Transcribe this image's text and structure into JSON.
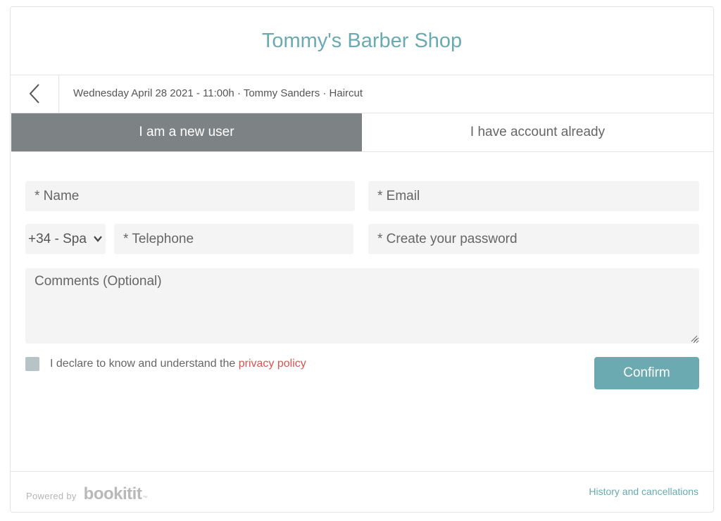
{
  "header": {
    "shop_name": "Tommy's Barber Shop"
  },
  "booking": {
    "back_icon": "chevron-left-icon",
    "summary": "Wednesday April 28 2021 - 11:00h · Tommy Sanders · Haircut"
  },
  "tabs": [
    {
      "label": "I am a new user",
      "active": true
    },
    {
      "label": "I have account already",
      "active": false
    }
  ],
  "form": {
    "name_placeholder": "* Name",
    "email_placeholder": "* Email",
    "country_value": "+34 - Spa",
    "telephone_placeholder": "* Telephone",
    "password_placeholder": "* Create your password",
    "comments_placeholder": "Comments (Optional)",
    "privacy_text": "I declare to know and understand the ",
    "privacy_link": "privacy policy",
    "checkbox_checked": false,
    "confirm_label": "Confirm"
  },
  "footer": {
    "powered_by": "Powered by",
    "brand": "bookitit",
    "brand_mark": "™",
    "history_link": "History and cancellations"
  },
  "colors": {
    "accent": "#6aaab0",
    "active_tab": "#7d8384",
    "link_red": "#d9534f",
    "field_bg": "#f4f4f4"
  }
}
